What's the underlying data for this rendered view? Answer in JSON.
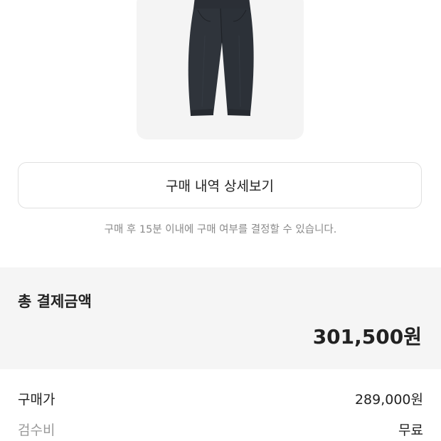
{
  "product": {
    "image": "navy-wide-pants-icon"
  },
  "purchase": {
    "detail_button_label": "구매 내역 상세보기",
    "notice": "구매 후 15분 이내에 구매 여부를 결정할 수 있습니다."
  },
  "total": {
    "label": "총 결제금액",
    "amount": "301,500원"
  },
  "breakdown": {
    "price_label": "구매가",
    "price_value": "289,000원",
    "fee_label": "검수비",
    "fee_value": "무료"
  }
}
